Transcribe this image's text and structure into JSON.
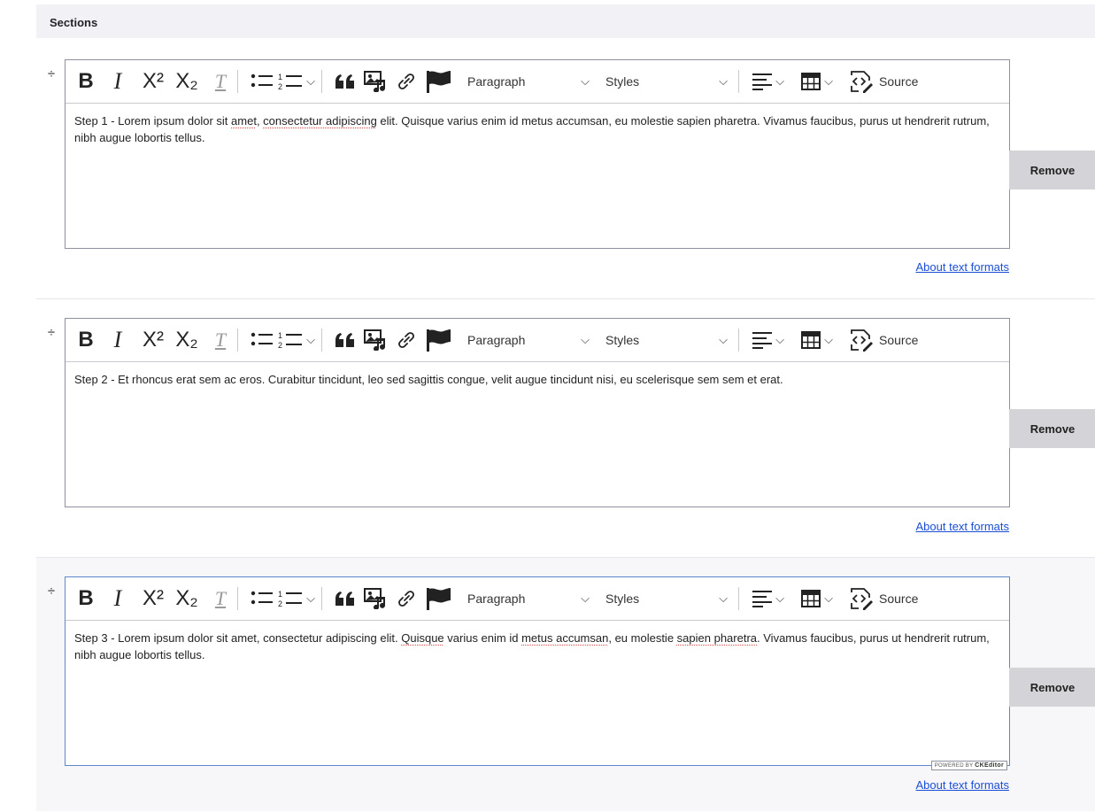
{
  "sections_title": "Sections",
  "toolbar": {
    "bold": "B",
    "italic": "I",
    "superscript": "X²",
    "subscript": "X₂",
    "remove_format": "T",
    "paragraph": "Paragraph",
    "styles": "Styles",
    "source": "Source"
  },
  "sections": [
    {
      "text_parts": [
        "Step 1 - Lorem ipsum dolor sit ",
        "amet",
        ", ",
        "consectetur adipiscing",
        " elit. Quisque varius enim id metus accumsan, eu molestie sapien pharetra. Vivamus faucibus, purus ut hendrerit rutrum, nibh augue lobortis tellus."
      ],
      "remove_label": "Remove",
      "about_link": "About text formats"
    },
    {
      "text_parts": [
        "Step 2 - Et rhoncus erat sem ac eros. Curabitur tincidunt, leo sed sagittis congue, velit augue tincidunt nisi, eu scelerisque sem sem et erat."
      ],
      "remove_label": "Remove",
      "about_link": "About text formats"
    },
    {
      "text_parts": [
        "Step 3 - Lorem ipsum dolor sit amet, consectetur adipiscing elit. ",
        "Quisque",
        " varius enim id ",
        "metus accumsan",
        ", eu molestie ",
        "sapien pharetra",
        ". Vivamus faucibus, purus ut hendrerit rutrum, nibh augue lobortis tellus."
      ],
      "remove_label": "Remove",
      "about_link": "About text formats",
      "powered_by": "POWERED BY",
      "powered_brand": "CKEditor"
    }
  ]
}
